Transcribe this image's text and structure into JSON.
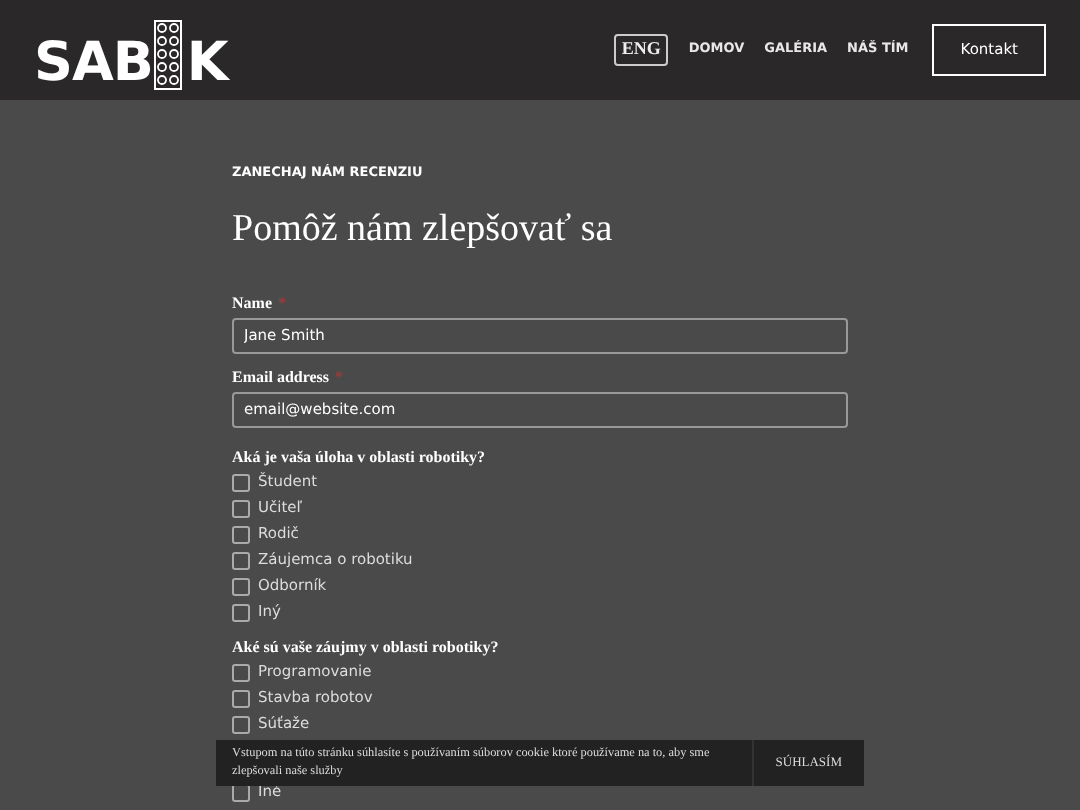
{
  "header": {
    "logo_left": "SAB",
    "logo_right": "K",
    "nav": [
      {
        "label": "ENG",
        "kind": "lang"
      },
      {
        "label": "DOMOV",
        "kind": "link"
      },
      {
        "label": "GALÉRIA",
        "kind": "link"
      },
      {
        "label": "NÁŠ TÍM",
        "kind": "link"
      },
      {
        "label": "Kontakt",
        "kind": "button"
      }
    ]
  },
  "eyebrow": "ZANECHAJ NÁM RECENZIU",
  "title": "Pomôž nám zlepšovať sa",
  "fields": [
    {
      "label": "Name",
      "required_mark": "*",
      "value": "Jane Smith"
    },
    {
      "label": "Email address",
      "required_mark": "*",
      "value": "email@website.com"
    }
  ],
  "questions": [
    {
      "label": "Aká je vaša úloha v oblasti robotiky?",
      "options": [
        {
          "label": "Študent",
          "checked": false
        },
        {
          "label": "Učiteľ",
          "checked": false
        },
        {
          "label": "Rodič",
          "checked": false
        },
        {
          "label": "Záujemca o robotiku",
          "checked": false
        },
        {
          "label": "Odborník",
          "checked": false
        },
        {
          "label": "Iný",
          "checked": false
        }
      ]
    },
    {
      "label": "Aké sú vaše záujmy v oblasti robotiky?",
      "options": [
        {
          "label": "Programovanie",
          "checked": false
        },
        {
          "label": "Stavba robotov",
          "checked": false
        },
        {
          "label": "Súťaže",
          "checked": false
        },
        {
          "label": "Iné",
          "checked": false
        }
      ]
    }
  ],
  "cookie_banner": {
    "text": "Vstupom na túto stránku súhlasíte s používaním súborov cookie ktoré používame na to, aby sme zlepšovali naše služby",
    "button": "SÚHLASÍM"
  }
}
